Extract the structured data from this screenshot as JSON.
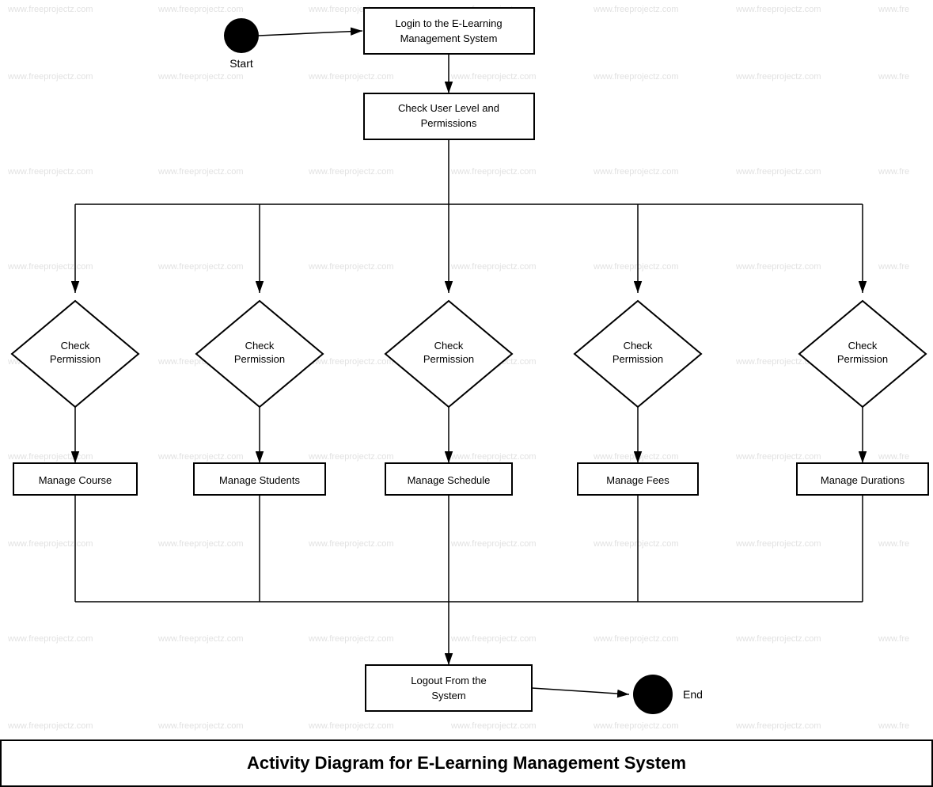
{
  "diagram": {
    "title": "Activity Diagram for E-Learning Management System",
    "watermark": "www.freeprojectz.com",
    "nodes": {
      "start_label": "Start",
      "end_label": "End",
      "login": "Login to the E-Learning\nManagement System",
      "check_user_level": "Check User Level and\nPermissions",
      "check_perm1": "Check\nPermission",
      "check_perm2": "Check\nPermission",
      "check_perm3": "Check\nPermission",
      "check_perm4": "Check\nPermission",
      "check_perm5": "Check\nPermission",
      "manage_course": "Manage Course",
      "manage_students": "Manage Students",
      "manage_schedule": "Manage Schedule",
      "manage_fees": "Manage Fees",
      "manage_durations": "Manage Durations",
      "logout": "Logout From the\nSystem"
    }
  }
}
